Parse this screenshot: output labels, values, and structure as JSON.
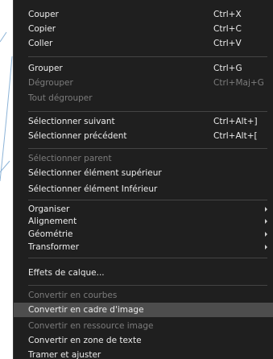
{
  "menu": {
    "items": [
      {
        "label": "Couper",
        "shortcut": "Ctrl+X",
        "enabled": true
      },
      {
        "label": "Copier",
        "shortcut": "Ctrl+C",
        "enabled": true
      },
      {
        "label": "Coller",
        "shortcut": "Ctrl+V",
        "enabled": true
      },
      {
        "label": "Grouper",
        "shortcut": "Ctrl+G",
        "enabled": true
      },
      {
        "label": "Dégrouper",
        "shortcut": "Ctrl+Maj+G",
        "enabled": false
      },
      {
        "label": "Tout dégrouper",
        "shortcut": "",
        "enabled": false
      },
      {
        "label": "Sélectionner suivant",
        "shortcut": "Ctrl+Alt+]",
        "enabled": true
      },
      {
        "label": "Sélectionner précédent",
        "shortcut": "Ctrl+Alt+[",
        "enabled": true
      },
      {
        "label": "Sélectionner parent",
        "shortcut": "",
        "enabled": false
      },
      {
        "label": "Sélectionner élément supérieur",
        "shortcut": "",
        "enabled": true
      },
      {
        "label": "Sélectionner élément Inférieur",
        "shortcut": "",
        "enabled": true
      },
      {
        "label": "Organiser",
        "shortcut": "",
        "enabled": true,
        "submenu": true
      },
      {
        "label": "Alignement",
        "shortcut": "",
        "enabled": true,
        "submenu": true
      },
      {
        "label": "Géométrie",
        "shortcut": "",
        "enabled": true,
        "submenu": true
      },
      {
        "label": "Transformer",
        "shortcut": "",
        "enabled": true,
        "submenu": true
      },
      {
        "label": "Effets de calque...",
        "shortcut": "",
        "enabled": true
      },
      {
        "label": "Convertir en courbes",
        "shortcut": "",
        "enabled": false
      },
      {
        "label": "Convertir en cadre d'image",
        "shortcut": "",
        "enabled": true,
        "highlighted": true
      },
      {
        "label": "Convertir en ressource image",
        "shortcut": "",
        "enabled": false
      },
      {
        "label": "Convertir en zone de texte",
        "shortcut": "",
        "enabled": true
      },
      {
        "label": "Tramer et ajuster",
        "shortcut": "",
        "enabled": true
      }
    ]
  },
  "colors": {
    "menu_background": "#1f1f1f",
    "text_enabled": "#ececec",
    "text_disabled": "#7c7c7c",
    "highlight": "#4d4d4d",
    "separator": "#444444"
  }
}
